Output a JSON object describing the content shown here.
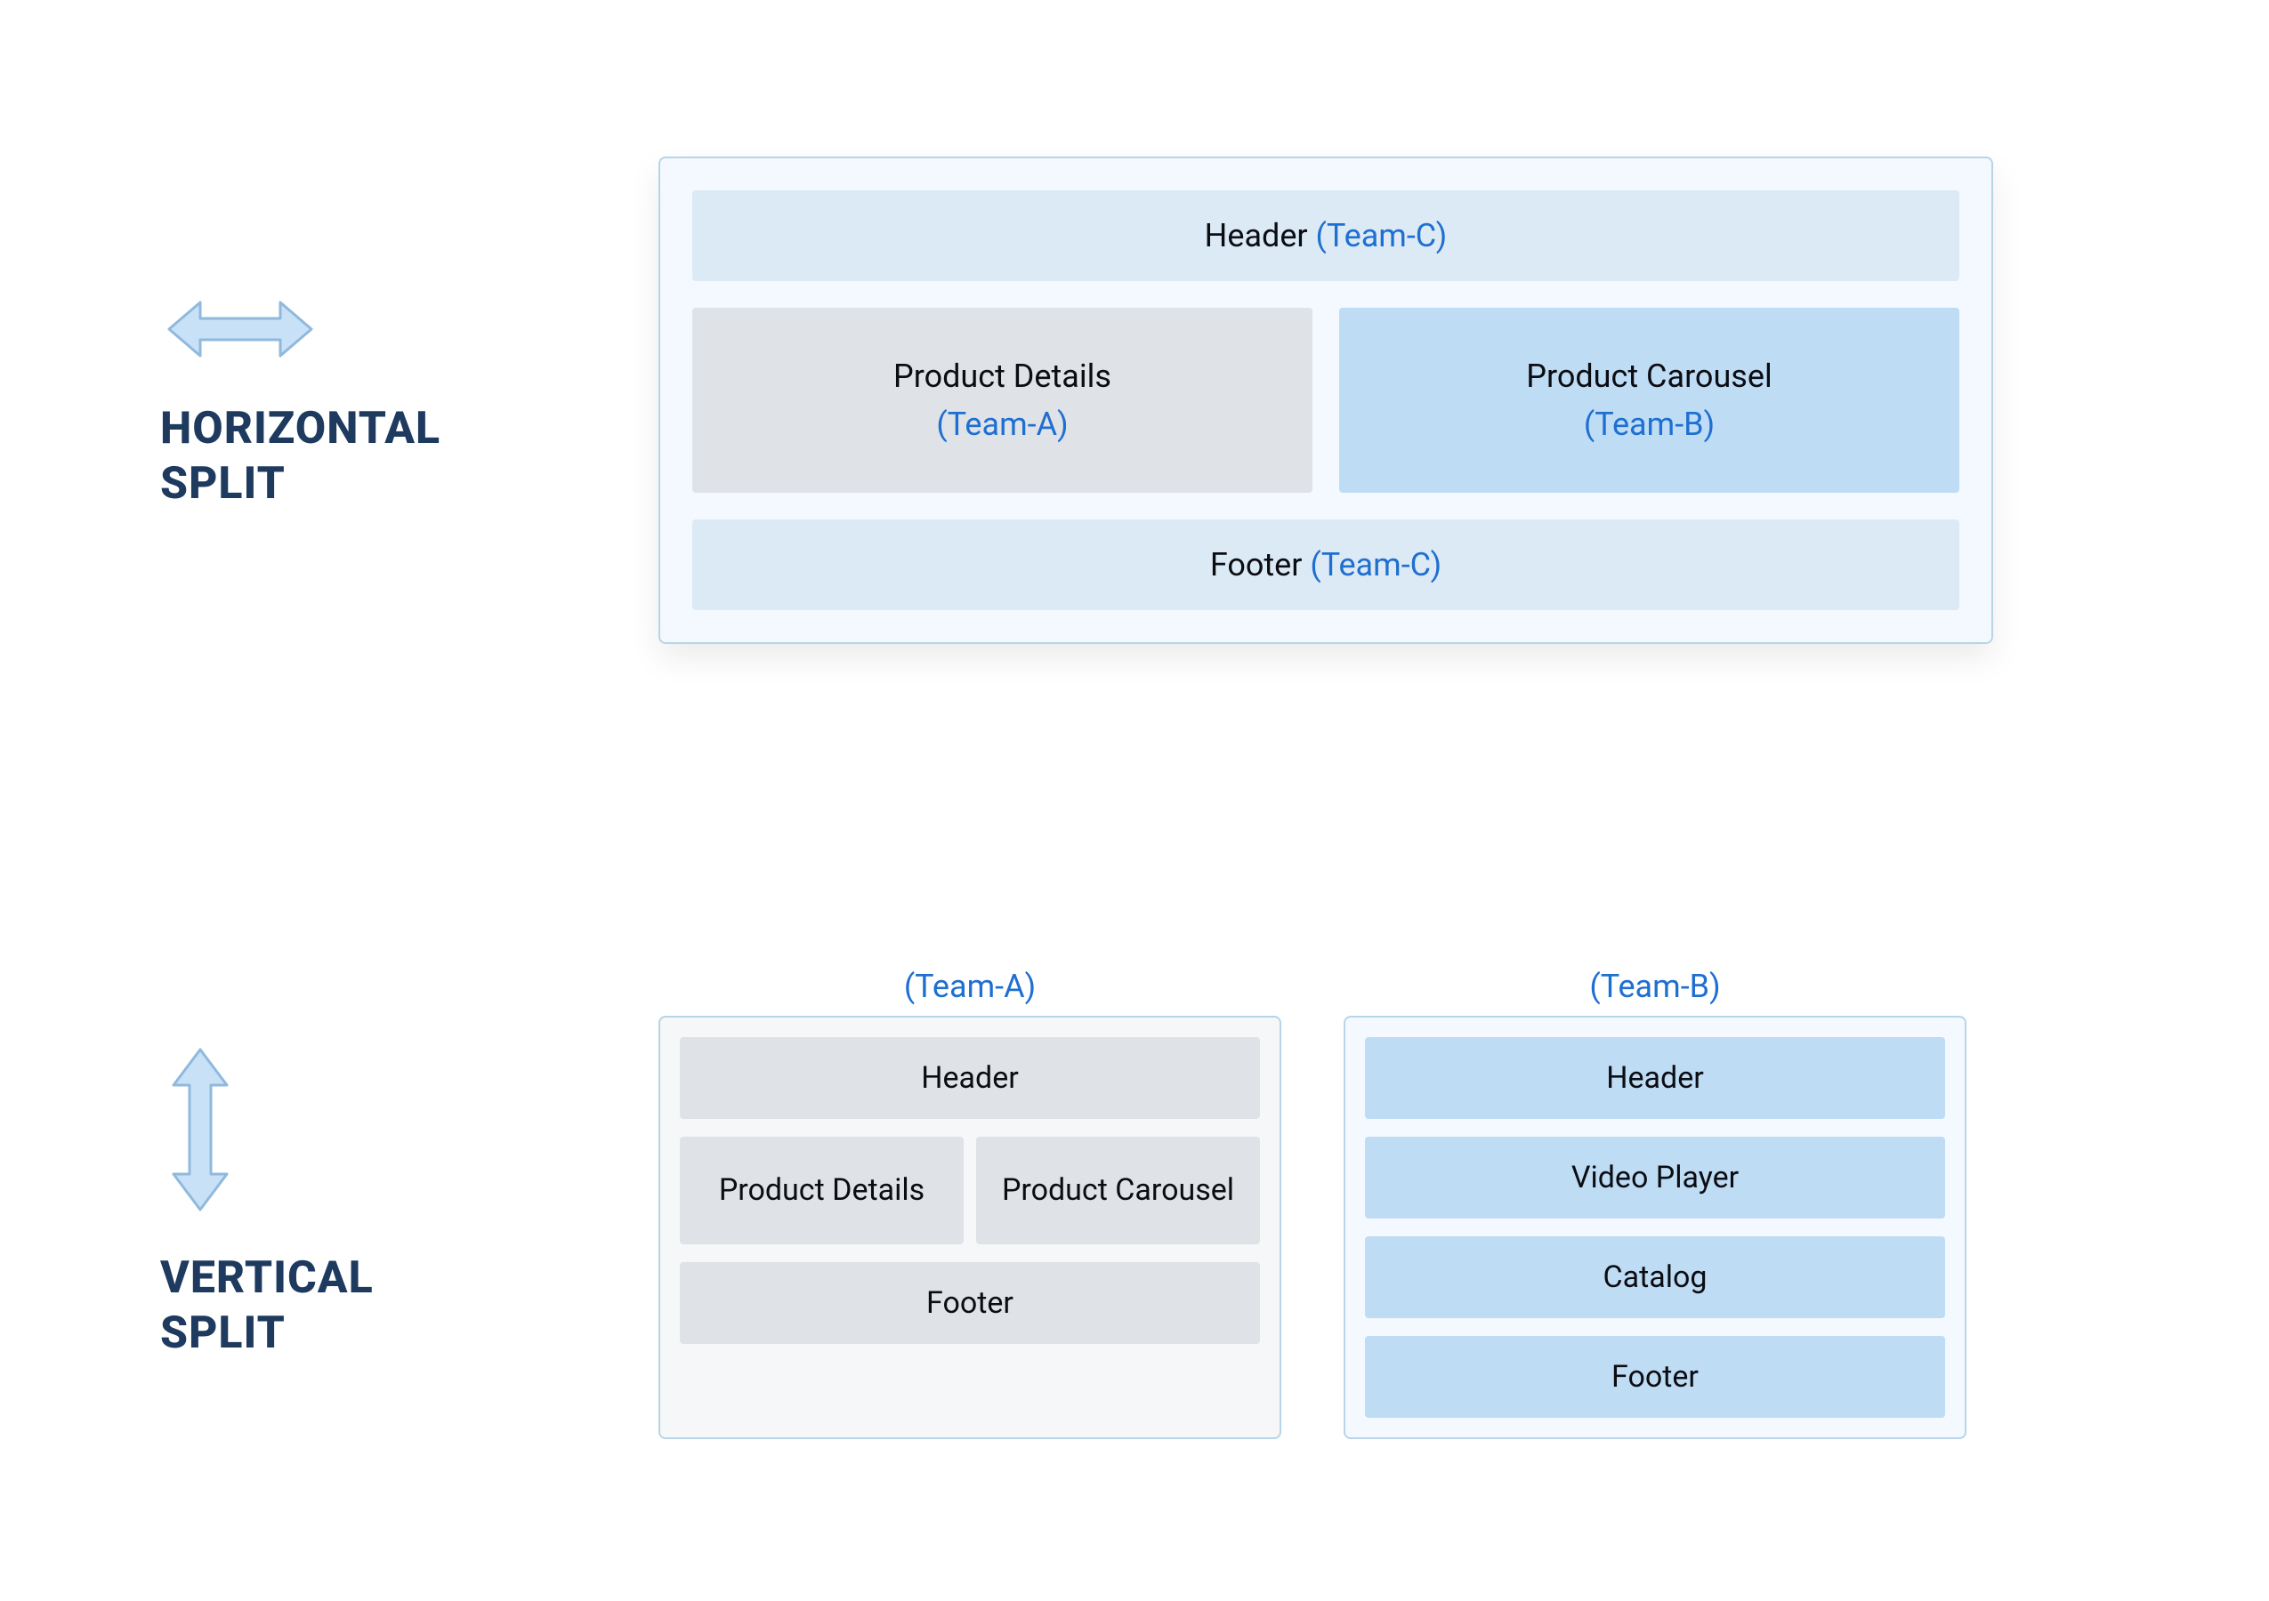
{
  "colors": {
    "accent_text": "#1f6fd1",
    "heading": "#1e3a5f",
    "arrow_fill": "#c9e1f7",
    "arrow_stroke": "#8fb9dd",
    "panel_border": "#b7d5e8",
    "panel_bg_blue": "#f3f9ff",
    "panel_bg_gray": "#f5f7f8",
    "block_blue": "#bfdcf5",
    "block_gray": "#dfe2e6",
    "block_lightblue": "#dceaf5"
  },
  "horizontal": {
    "title_line1": "HORIZONTAL",
    "title_line2": "SPLIT",
    "header_label": "Header ",
    "header_team": "(Team-C)",
    "details_label": "Product Details",
    "details_team": "(Team-A)",
    "carousel_label": "Product Carousel",
    "carousel_team": "(Team-B)",
    "footer_label": "Footer ",
    "footer_team": "(Team-C)"
  },
  "vertical": {
    "title_line1": "VERTICAL",
    "title_line2": "SPLIT",
    "panel_a": {
      "team": "(Team-A)",
      "header": "Header",
      "details": "Product Details",
      "carousel": "Product Carousel",
      "footer": "Footer"
    },
    "panel_b": {
      "team": "(Team-B)",
      "header": "Header",
      "video": "Video Player",
      "catalog": "Catalog",
      "footer": "Footer"
    }
  }
}
